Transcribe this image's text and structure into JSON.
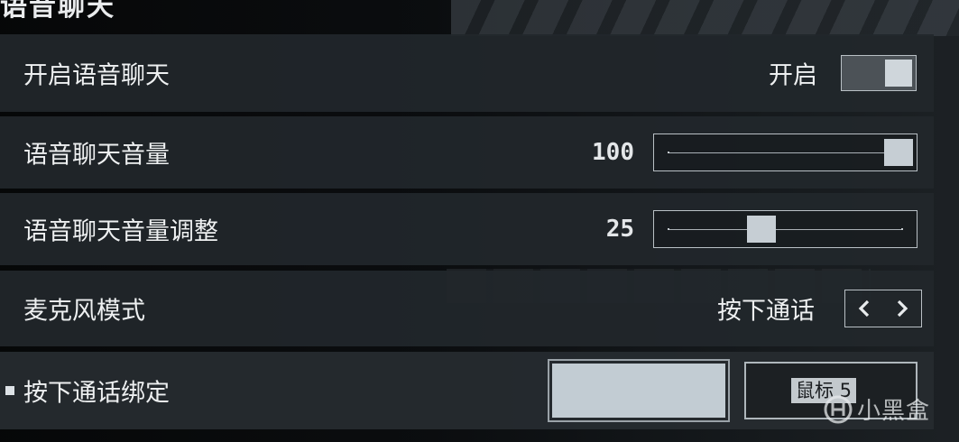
{
  "section": {
    "title": "语音聊天"
  },
  "settings": {
    "voice_chat": {
      "label": "开启语音聊天",
      "value_text": "开启",
      "enabled": true
    },
    "voice_volume": {
      "label": "语音聊天音量",
      "value": "100",
      "level_percent": 100
    },
    "voice_volume_adjust": {
      "label": "语音聊天音量调整",
      "value": "25",
      "level_percent": 25
    },
    "mic_mode": {
      "label": "麦克风模式",
      "value_text": "按下通话",
      "prev_icon": "chevron-left-icon",
      "next_icon": "chevron-right-icon"
    },
    "ptt_binding": {
      "label": "按下通话绑定",
      "primary_binding": "",
      "secondary_binding": "鼠标 5"
    }
  },
  "watermark": {
    "text": "小黑盒"
  },
  "colors": {
    "row_bg": "#22272b",
    "knob": "#c6ced4",
    "border": "#b9c0c5",
    "text": "#eef0f1"
  }
}
